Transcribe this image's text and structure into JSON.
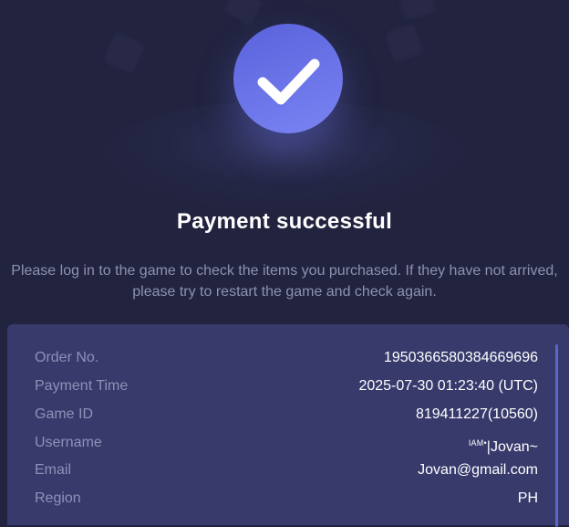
{
  "header": {
    "title": "Payment successful",
    "description": "Please log in to the game to check the items you purchased. If they have not arrived, please try to restart the game and check again.",
    "status_icon": "check-icon"
  },
  "colors": {
    "background": "#21233f",
    "panel": "#383a6c",
    "accent": "#6a72e8",
    "label": "#8e91b6",
    "value": "#ffffff"
  },
  "order": {
    "order_no_label": "Order No.",
    "order_no": "1950366580384669696",
    "payment_time_label": "Payment Time",
    "payment_time": "2025-07-30 01:23:40 (UTC)",
    "game_id_label": "Game ID",
    "game_id": "819411227(10560)",
    "username_label": "Username",
    "username_prefix": "IAM•",
    "username_main": "|Jovan~",
    "email_label": "Email",
    "email": "Jovan@gmail.com",
    "region_label": "Region",
    "region": "PH"
  }
}
